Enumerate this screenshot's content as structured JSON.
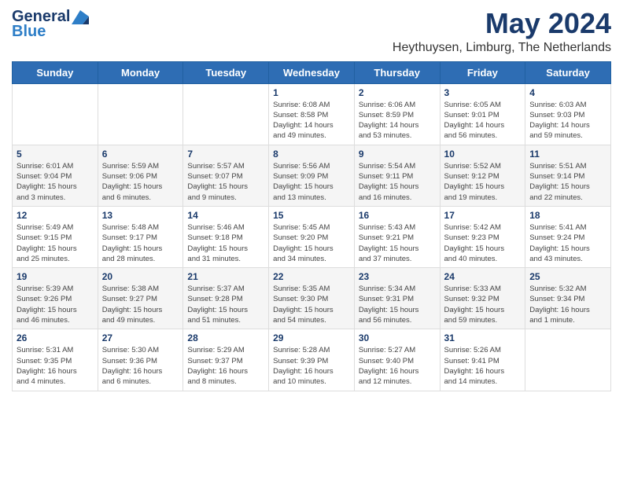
{
  "logo": {
    "line1": "General",
    "line2": "Blue"
  },
  "title": "May 2024",
  "location": "Heythuysen, Limburg, The Netherlands",
  "days_of_week": [
    "Sunday",
    "Monday",
    "Tuesday",
    "Wednesday",
    "Thursday",
    "Friday",
    "Saturday"
  ],
  "weeks": [
    [
      {
        "day": "",
        "info": ""
      },
      {
        "day": "",
        "info": ""
      },
      {
        "day": "",
        "info": ""
      },
      {
        "day": "1",
        "info": "Sunrise: 6:08 AM\nSunset: 8:58 PM\nDaylight: 14 hours\nand 49 minutes."
      },
      {
        "day": "2",
        "info": "Sunrise: 6:06 AM\nSunset: 8:59 PM\nDaylight: 14 hours\nand 53 minutes."
      },
      {
        "day": "3",
        "info": "Sunrise: 6:05 AM\nSunset: 9:01 PM\nDaylight: 14 hours\nand 56 minutes."
      },
      {
        "day": "4",
        "info": "Sunrise: 6:03 AM\nSunset: 9:03 PM\nDaylight: 14 hours\nand 59 minutes."
      }
    ],
    [
      {
        "day": "5",
        "info": "Sunrise: 6:01 AM\nSunset: 9:04 PM\nDaylight: 15 hours\nand 3 minutes."
      },
      {
        "day": "6",
        "info": "Sunrise: 5:59 AM\nSunset: 9:06 PM\nDaylight: 15 hours\nand 6 minutes."
      },
      {
        "day": "7",
        "info": "Sunrise: 5:57 AM\nSunset: 9:07 PM\nDaylight: 15 hours\nand 9 minutes."
      },
      {
        "day": "8",
        "info": "Sunrise: 5:56 AM\nSunset: 9:09 PM\nDaylight: 15 hours\nand 13 minutes."
      },
      {
        "day": "9",
        "info": "Sunrise: 5:54 AM\nSunset: 9:11 PM\nDaylight: 15 hours\nand 16 minutes."
      },
      {
        "day": "10",
        "info": "Sunrise: 5:52 AM\nSunset: 9:12 PM\nDaylight: 15 hours\nand 19 minutes."
      },
      {
        "day": "11",
        "info": "Sunrise: 5:51 AM\nSunset: 9:14 PM\nDaylight: 15 hours\nand 22 minutes."
      }
    ],
    [
      {
        "day": "12",
        "info": "Sunrise: 5:49 AM\nSunset: 9:15 PM\nDaylight: 15 hours\nand 25 minutes."
      },
      {
        "day": "13",
        "info": "Sunrise: 5:48 AM\nSunset: 9:17 PM\nDaylight: 15 hours\nand 28 minutes."
      },
      {
        "day": "14",
        "info": "Sunrise: 5:46 AM\nSunset: 9:18 PM\nDaylight: 15 hours\nand 31 minutes."
      },
      {
        "day": "15",
        "info": "Sunrise: 5:45 AM\nSunset: 9:20 PM\nDaylight: 15 hours\nand 34 minutes."
      },
      {
        "day": "16",
        "info": "Sunrise: 5:43 AM\nSunset: 9:21 PM\nDaylight: 15 hours\nand 37 minutes."
      },
      {
        "day": "17",
        "info": "Sunrise: 5:42 AM\nSunset: 9:23 PM\nDaylight: 15 hours\nand 40 minutes."
      },
      {
        "day": "18",
        "info": "Sunrise: 5:41 AM\nSunset: 9:24 PM\nDaylight: 15 hours\nand 43 minutes."
      }
    ],
    [
      {
        "day": "19",
        "info": "Sunrise: 5:39 AM\nSunset: 9:26 PM\nDaylight: 15 hours\nand 46 minutes."
      },
      {
        "day": "20",
        "info": "Sunrise: 5:38 AM\nSunset: 9:27 PM\nDaylight: 15 hours\nand 49 minutes."
      },
      {
        "day": "21",
        "info": "Sunrise: 5:37 AM\nSunset: 9:28 PM\nDaylight: 15 hours\nand 51 minutes."
      },
      {
        "day": "22",
        "info": "Sunrise: 5:35 AM\nSunset: 9:30 PM\nDaylight: 15 hours\nand 54 minutes."
      },
      {
        "day": "23",
        "info": "Sunrise: 5:34 AM\nSunset: 9:31 PM\nDaylight: 15 hours\nand 56 minutes."
      },
      {
        "day": "24",
        "info": "Sunrise: 5:33 AM\nSunset: 9:32 PM\nDaylight: 15 hours\nand 59 minutes."
      },
      {
        "day": "25",
        "info": "Sunrise: 5:32 AM\nSunset: 9:34 PM\nDaylight: 16 hours\nand 1 minute."
      }
    ],
    [
      {
        "day": "26",
        "info": "Sunrise: 5:31 AM\nSunset: 9:35 PM\nDaylight: 16 hours\nand 4 minutes."
      },
      {
        "day": "27",
        "info": "Sunrise: 5:30 AM\nSunset: 9:36 PM\nDaylight: 16 hours\nand 6 minutes."
      },
      {
        "day": "28",
        "info": "Sunrise: 5:29 AM\nSunset: 9:37 PM\nDaylight: 16 hours\nand 8 minutes."
      },
      {
        "day": "29",
        "info": "Sunrise: 5:28 AM\nSunset: 9:39 PM\nDaylight: 16 hours\nand 10 minutes."
      },
      {
        "day": "30",
        "info": "Sunrise: 5:27 AM\nSunset: 9:40 PM\nDaylight: 16 hours\nand 12 minutes."
      },
      {
        "day": "31",
        "info": "Sunrise: 5:26 AM\nSunset: 9:41 PM\nDaylight: 16 hours\nand 14 minutes."
      },
      {
        "day": "",
        "info": ""
      }
    ]
  ]
}
